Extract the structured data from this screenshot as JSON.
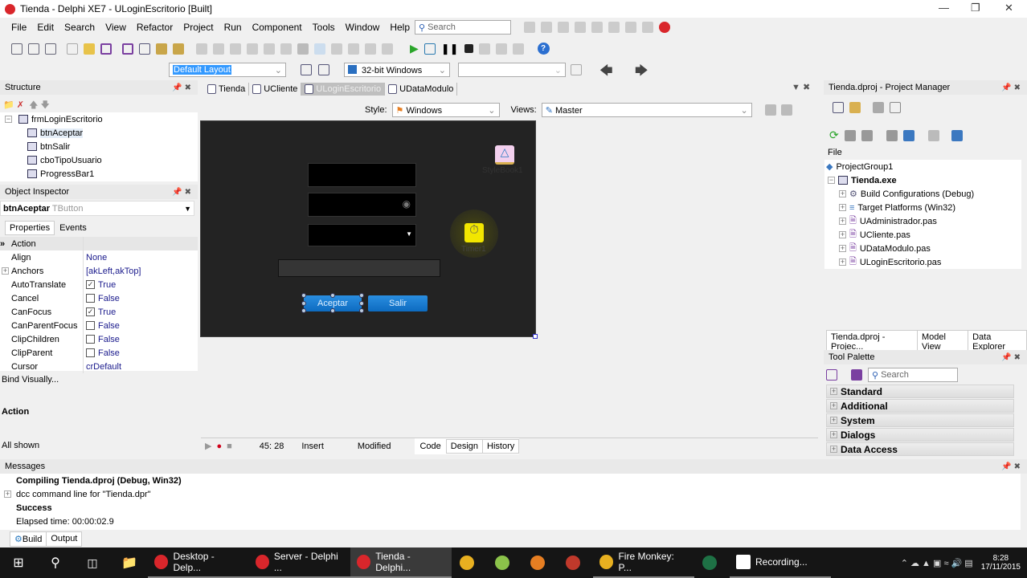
{
  "window": {
    "title": "Tienda - Delphi XE7 - ULoginEscritorio [Built]"
  },
  "menu": [
    "File",
    "Edit",
    "Search",
    "View",
    "Refactor",
    "Project",
    "Run",
    "Component",
    "Tools",
    "Window",
    "Help"
  ],
  "search_placeholder": "Search",
  "toolbar": {
    "layout": "Default Layout",
    "platform": "32-bit Windows",
    "config": ""
  },
  "structure": {
    "title": "Structure",
    "items": [
      "frmLoginEscritorio",
      "btnAceptar",
      "btnSalir",
      "cboTipoUsuario",
      "ProgressBar1"
    ]
  },
  "inspector": {
    "title": "Object Inspector",
    "object_name": "btnAceptar",
    "object_type": "TButton",
    "tabs": [
      "Properties",
      "Events"
    ],
    "rows": [
      {
        "k": "Action",
        "v": "",
        "cb": null
      },
      {
        "k": "Align",
        "v": "None",
        "cb": null
      },
      {
        "k": "Anchors",
        "v": "[akLeft,akTop]",
        "cb": null
      },
      {
        "k": "AutoTranslate",
        "v": "True",
        "cb": true
      },
      {
        "k": "Cancel",
        "v": "False",
        "cb": false
      },
      {
        "k": "CanFocus",
        "v": "True",
        "cb": true
      },
      {
        "k": "CanParentFocus",
        "v": "False",
        "cb": false
      },
      {
        "k": "ClipChildren",
        "v": "False",
        "cb": false
      },
      {
        "k": "ClipParent",
        "v": "False",
        "cb": false
      },
      {
        "k": "Cursor",
        "v": "crDefault",
        "cb": null
      }
    ],
    "bind_visually": "Bind Visually...",
    "desc_title": "Action",
    "filter": "All shown"
  },
  "editor": {
    "tabs": [
      "Tienda",
      "UCliente",
      "ULoginEscritorio",
      "UDataModulo"
    ],
    "active_tab": 2,
    "style_label": "Style:",
    "style_value": "Windows",
    "views_label": "Views:",
    "views_value": "Master"
  },
  "form": {
    "btn_aceptar": "Aceptar",
    "btn_salir": "Salir",
    "stylebook": "StyleBook1",
    "timer": "Timer1"
  },
  "status": {
    "position": "45: 28",
    "mode": "Insert",
    "state": "Modified",
    "tabs": [
      "Code",
      "Design",
      "History"
    ]
  },
  "messages": {
    "title": "Messages",
    "lines": [
      {
        "text": "Compiling Tienda.dproj (Debug, Win32)",
        "bold": true
      },
      {
        "text": "dcc command line for \"Tienda.dpr\"",
        "bold": false
      },
      {
        "text": "Success",
        "bold": true
      },
      {
        "text": "Elapsed time: 00:00:02.9",
        "bold": false
      }
    ],
    "tabs": [
      "Build",
      "Output"
    ]
  },
  "project_manager": {
    "title": "Tienda.dproj - Project Manager",
    "file_label": "File",
    "group": "ProjectGroup1",
    "project": "Tienda.exe",
    "items": [
      "Build Configurations (Debug)",
      "Target Platforms (Win32)",
      "UAdministrador.pas",
      "UCliente.pas",
      "UDataModulo.pas",
      "ULoginEscritorio.pas"
    ],
    "tabs": [
      "Tienda.dproj - Projec...",
      "Model View",
      "Data Explorer"
    ]
  },
  "tool_palette": {
    "title": "Tool Palette",
    "search_placeholder": "Search",
    "categories": [
      "Standard",
      "Additional",
      "System",
      "Dialogs",
      "Data Access"
    ]
  },
  "taskbar": {
    "apps": [
      {
        "label": "Desktop - Delp...",
        "color": "#d9262b"
      },
      {
        "label": "Server - Delphi ...",
        "color": "#d9262b"
      },
      {
        "label": "Tienda - Delphi...",
        "color": "#d9262b"
      },
      {
        "label": "",
        "color": "#e8b020"
      },
      {
        "label": "",
        "color": "#8bc34a"
      },
      {
        "label": "",
        "color": "#e67e22"
      },
      {
        "label": "",
        "color": "#c0392b"
      },
      {
        "label": "Fire Monkey: P...",
        "color": "#e8b020"
      },
      {
        "label": "",
        "color": "#1e7145"
      },
      {
        "label": "Recording...",
        "color": "#ffffff"
      }
    ],
    "time": "8:28",
    "date": "17/11/2015"
  },
  "colors": {
    "accent": "#0d6bc0",
    "form_bg": "#232323",
    "selection": "#3399ff"
  }
}
